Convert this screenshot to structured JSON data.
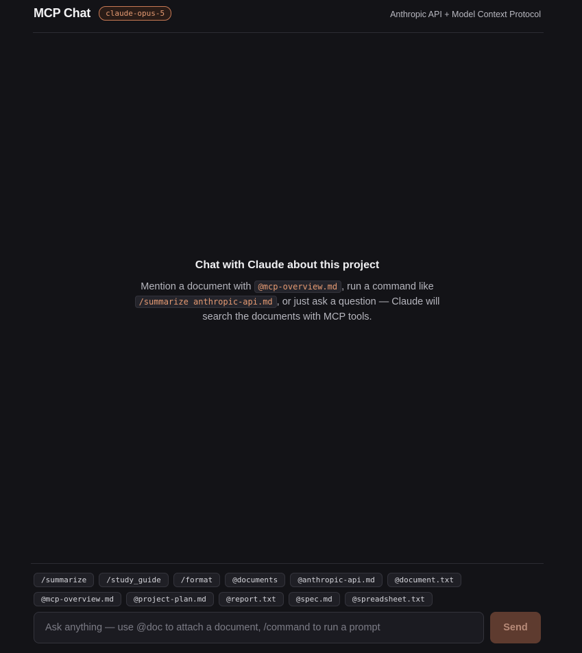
{
  "header": {
    "title": "MCP Chat",
    "model_badge": "claude-opus-5",
    "subtitle": "Anthropic API + Model Context Protocol"
  },
  "empty_state": {
    "title": "Chat with Claude about this project",
    "desc_part1": "Mention a document with ",
    "desc_code1": "@mcp-overview.md",
    "desc_part2": ", run a command like ",
    "desc_code2": "/summarize anthropic-api.md",
    "desc_part3": ", or just ask a question — Claude will search the documents with MCP tools."
  },
  "chips": [
    "/summarize",
    "/study_guide",
    "/format",
    "@documents",
    "@anthropic-api.md",
    "@document.txt",
    "@mcp-overview.md",
    "@project-plan.md",
    "@report.txt",
    "@spec.md",
    "@spreadsheet.txt"
  ],
  "composer": {
    "placeholder": "Ask anything — use @doc to attach a document, /command to run a prompt",
    "value": "",
    "send_label": "Send"
  },
  "colors": {
    "background": "#131317",
    "accent": "#e59a72",
    "send_disabled": "#5e3b2f"
  }
}
